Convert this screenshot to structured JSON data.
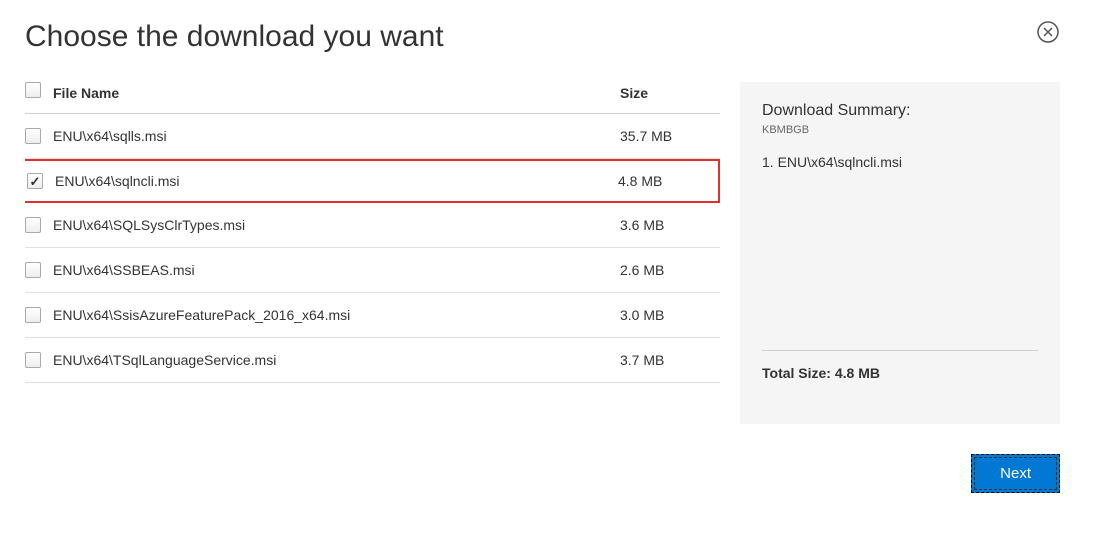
{
  "title": "Choose the download you want",
  "table": {
    "headers": {
      "name": "File Name",
      "size": "Size"
    },
    "rows": [
      {
        "name": "ENU\\x64\\sqlls.msi",
        "size": "35.7 MB",
        "checked": false,
        "highlighted": false
      },
      {
        "name": "ENU\\x64\\sqlncli.msi",
        "size": "4.8 MB",
        "checked": true,
        "highlighted": true
      },
      {
        "name": "ENU\\x64\\SQLSysClrTypes.msi",
        "size": "3.6 MB",
        "checked": false,
        "highlighted": false
      },
      {
        "name": "ENU\\x64\\SSBEAS.msi",
        "size": "2.6 MB",
        "checked": false,
        "highlighted": false
      },
      {
        "name": "ENU\\x64\\SsisAzureFeaturePack_2016_x64.msi",
        "size": "3.0 MB",
        "checked": false,
        "highlighted": false
      },
      {
        "name": "ENU\\x64\\TSqlLanguageService.msi",
        "size": "3.7 MB",
        "checked": false,
        "highlighted": false
      }
    ]
  },
  "summary": {
    "title": "Download Summary:",
    "unit": "KBMBGB",
    "items": [
      "1.  ENU\\x64\\sqlncli.msi"
    ],
    "total_label": "Total Size:",
    "total_value": "4.8 MB"
  },
  "footer": {
    "next_label": "Next"
  }
}
